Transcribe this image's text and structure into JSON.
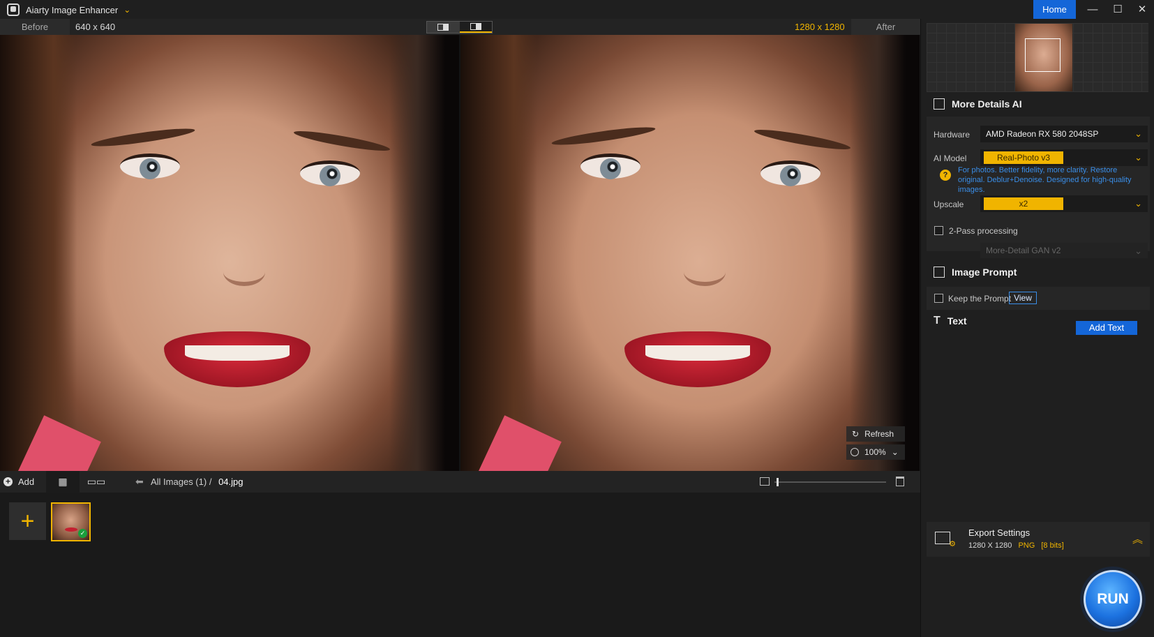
{
  "app": {
    "title": "Aiarty Image Enhancer",
    "home_label": "Home"
  },
  "window_controls": {
    "minimize": "—",
    "maximize": "☐",
    "close": "✕"
  },
  "compare": {
    "before_label": "Before",
    "before_size": "640 x 640",
    "after_size": "1280 x 1280",
    "after_label": "After"
  },
  "preview_controls": {
    "refresh_label": "Refresh",
    "zoom_level": "100%"
  },
  "bottom_bar": {
    "add_label": "Add",
    "breadcrumb_root": "All Images (1)",
    "breadcrumb_sep": "/",
    "breadcrumb_file": "04.jpg",
    "thumb_size_level": 0.02
  },
  "thumbnails": {
    "add_tile": "+"
  },
  "panel": {
    "model_section": "More Details AI",
    "hardware_label": "Hardware",
    "hardware_value": "AMD Radeon RX 580 2048SP",
    "ai_model_label": "AI Model",
    "ai_model_value": "Real-Photo v3",
    "ai_model_desc": "For photos. Better fidelity, more clarity. Restore original. Deblur+Denoise. Designed for high-quality images.",
    "upscale_label": "Upscale",
    "upscale_value": "x2",
    "two_pass_label": "2-Pass processing",
    "two_pass_model": "More-Detail GAN v2",
    "prompt_section": "Image Prompt",
    "keep_prompt_label": "Keep the Prompt",
    "view_label": "View",
    "text_section": "Text",
    "add_text_label": "Add Text"
  },
  "export": {
    "title": "Export Settings",
    "size": "1280 X 1280",
    "format": "PNG",
    "bits": "[8 bits]"
  },
  "run_label": "RUN",
  "colors": {
    "accent": "#f0b400",
    "primary": "#1466d8",
    "link": "#3a8ee8"
  }
}
